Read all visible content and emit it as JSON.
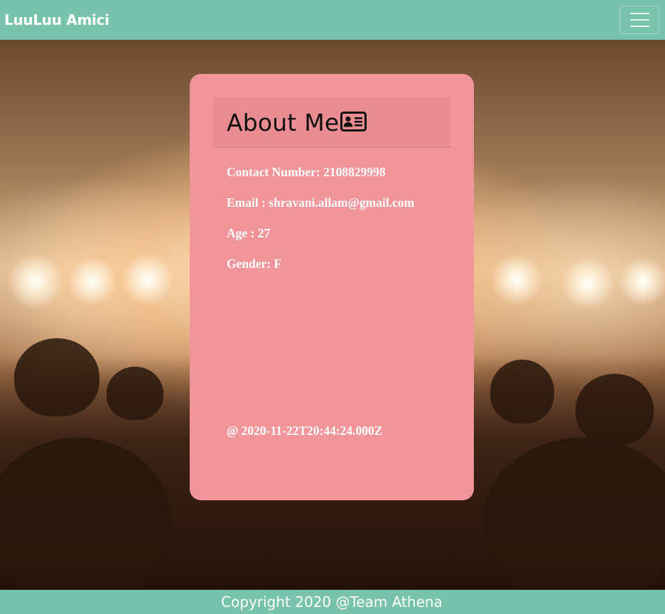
{
  "navbar": {
    "brand": "LuuLuu Amici",
    "menu_icon": "hamburger-menu-icon"
  },
  "card": {
    "title": "About Me",
    "title_icon": "id-card-icon",
    "contact": "Contact Number: 2108829998",
    "email": "Email : shravani.allam@gmail.com",
    "age": "Age : 27",
    "gender": "Gender: F",
    "timestamp": "@ 2020-11-22T20:44:24.000Z"
  },
  "footer": {
    "text": "Copyright 2020 @Team Athena"
  },
  "colors": {
    "navbar": "#79c2ac",
    "card": "#f2959a",
    "card_header": "#ea8d93"
  }
}
